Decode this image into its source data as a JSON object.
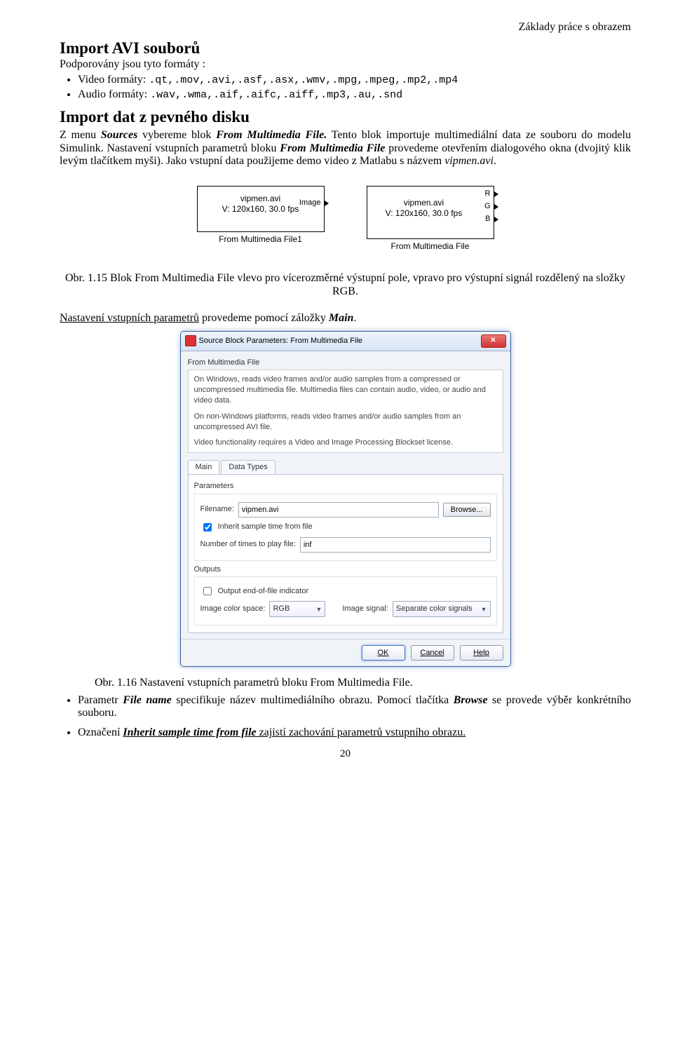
{
  "header": {
    "right": "Základy práce  s obrazem"
  },
  "s1": {
    "title": "Import AVI souborů",
    "sub": "Podporovány jsou tyto formáty :",
    "b1_label": "Video formáty:",
    "b1_code": ".qt,.mov,.avi,.asf,.asx,.wmv,.mpg,.mpeg,.mp2,.mp4",
    "b2_label": "Audio formáty:",
    "b2_code": ".wav,.wma,.aif,.aifc,.aiff,.mp3,.au,.snd"
  },
  "s2": {
    "title": "Import dat z pevného disku",
    "p1a": "Z menu ",
    "p1b": "Sources",
    "p1c": " vybereme blok ",
    "p1d": "From Multimedia File.",
    "p1e": " Tento blok importuje multimediální data ze souboru do modelu Simulink. Nastavení vstupních parametrů bloku ",
    "p1f": "From Multimedia File",
    "p1g": " provedeme otevřením dialogového okna (dvojitý klik levým tlačítkem myši). Jako vstupní data použijeme demo video z Matlabu s názvem ",
    "p1h": "vipmen.avi",
    "p1i": "."
  },
  "blocks": {
    "left": {
      "line1": "vipmen.avi",
      "line2": "V: 120x160, 30.0 fps",
      "port": "Image",
      "caption": "From Multimedia File1"
    },
    "right": {
      "line1": "vipmen.avi",
      "line2": "V: 120x160, 30.0 fps",
      "r": "R",
      "g": "G",
      "b": "B",
      "caption": "From Multimedia File"
    }
  },
  "fig15": "Obr. 1.15 Blok From Multimedia File vlevo pro vícerozměrné výstupní pole, vpravo pro výstupní signál rozdělený na složky RGB.",
  "para3a": "Nastavení vstupních parametrů",
  "para3b": " provedeme pomocí záložky ",
  "para3c": "Main",
  "para3d": ".",
  "dialog": {
    "title": "Source Block Parameters: From Multimedia File",
    "group": "From Multimedia File",
    "desc1": "On Windows, reads video frames and/or audio samples from a compressed or uncompressed multimedia file. Multimedia files can contain audio, video, or audio and video data.",
    "desc2": "On non-Windows platforms, reads video frames and/or audio samples from an uncompressed AVI file.",
    "desc3": "Video functionality requires a Video and Image Processing Blockset license.",
    "tab_main": "Main",
    "tab_dt": "Data Types",
    "params": "Parameters",
    "fn_label": "Filename:",
    "fn_value": "vipmen.avi",
    "browse": "Browse...",
    "inherit": "Inherit sample time from file",
    "loop_label": "Number of times to play file:",
    "loop_value": "inf",
    "outputs": "Outputs",
    "eof": "Output end-of-file indicator",
    "ics_label": "Image color space:",
    "ics_value": "RGB",
    "is_label": "Image signal:",
    "is_value": "Separate color signals",
    "ok": "OK",
    "cancel": "Cancel",
    "help": "Help"
  },
  "fig16": "Obr. 1.16 Nastavení vstupních parametrů bloku From Multimedia File.",
  "b3a": "Parametr ",
  "b3b": "File name",
  "b3c": " specifikuje název multimediálního obrazu. Pomocí tlačítka ",
  "b3d": "Browse",
  "b3e": " se provede výběr konkrétního souboru.",
  "b4a": "Označení ",
  "b4b": "Inherit sample time from file",
  "b4c": " zajistí zachování parametrů vstupního obrazu.",
  "pagenum": "20"
}
